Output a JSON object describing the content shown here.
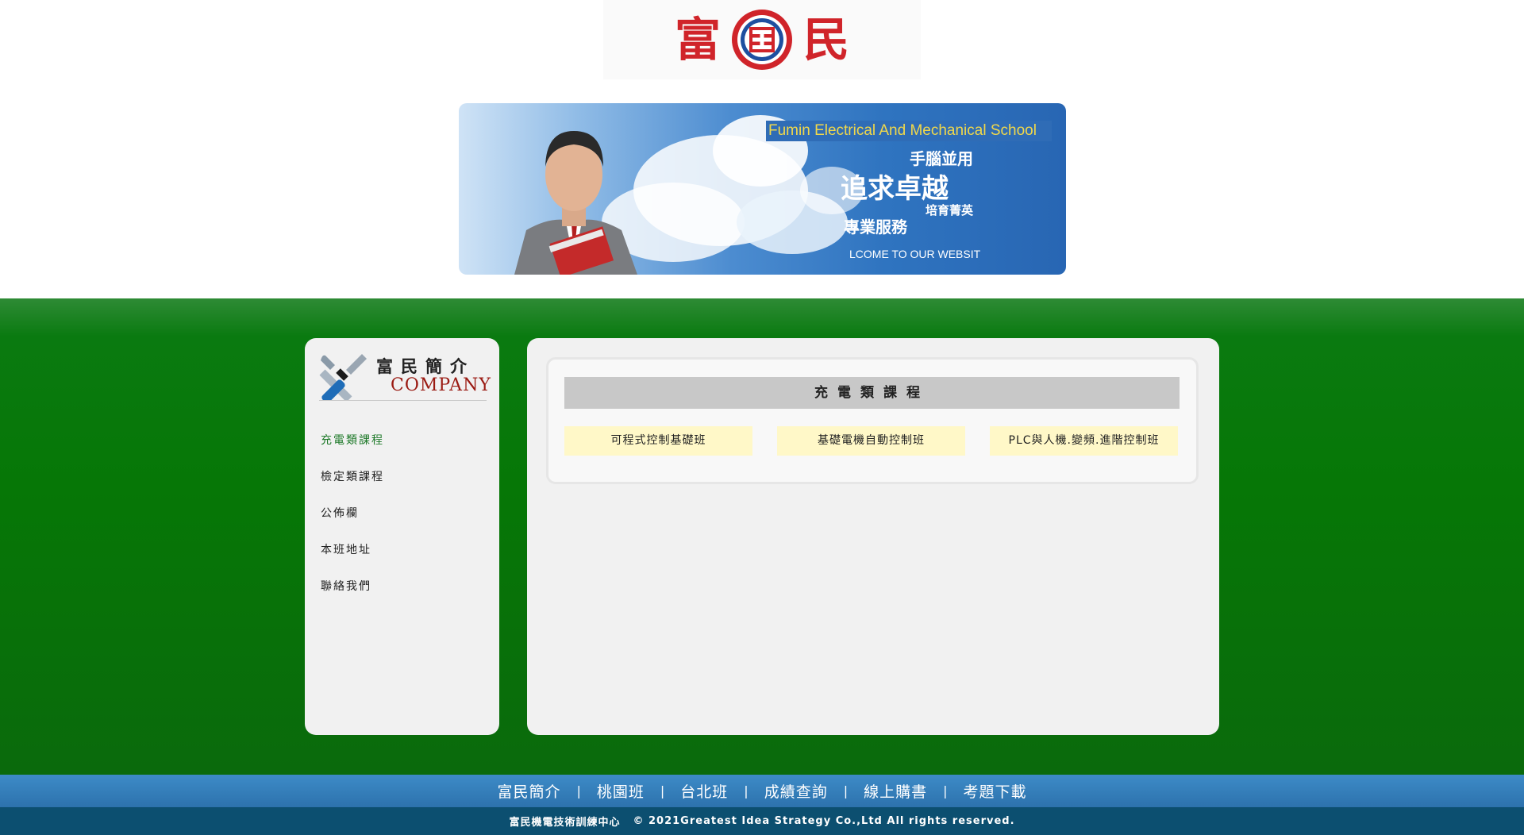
{
  "header": {
    "logo_char_left": "富",
    "logo_char_right": "民",
    "logo_color": "#d0242a"
  },
  "banner": {
    "english_title": "Fumin Electrical And Mechanical School",
    "slogan_1": "手腦並用",
    "slogan_2": "追求卓越",
    "slogan_3": "培育菁英",
    "slogan_4": "專業服務",
    "welcome": "LCOME TO OUR WEBSIT"
  },
  "sidebar": {
    "title": "富民簡介",
    "subtitle": "COMPANY",
    "items": [
      {
        "label": "充電類課程",
        "active": true
      },
      {
        "label": "檢定類課程",
        "active": false
      },
      {
        "label": "公佈欄",
        "active": false
      },
      {
        "label": "本班地址",
        "active": false
      },
      {
        "label": "聯絡我們",
        "active": false
      }
    ]
  },
  "main": {
    "section_title": "充電類課程",
    "courses": [
      {
        "label": "可程式控制基礎班"
      },
      {
        "label": "基礎電機自動控制班"
      },
      {
        "label": "PLC與人機.變頻.進階控制班"
      }
    ]
  },
  "footer": {
    "nav": [
      {
        "label": "富民簡介"
      },
      {
        "label": "桃園班"
      },
      {
        "label": "台北班"
      },
      {
        "label": "成績查詢"
      },
      {
        "label": "線上購書"
      },
      {
        "label": "考題下載"
      }
    ],
    "separator": "|",
    "org_name": "富民機電技術訓練中心",
    "copyright": "© 2021Greatest Idea Strategy Co.,Ltd All rights reserved."
  },
  "colors": {
    "green": "#067706",
    "footer_blue": "#2d72ad",
    "footer_dark": "#0c4f70",
    "course_bg": "#fff8c8",
    "active_nav": "#1f7a2a"
  }
}
